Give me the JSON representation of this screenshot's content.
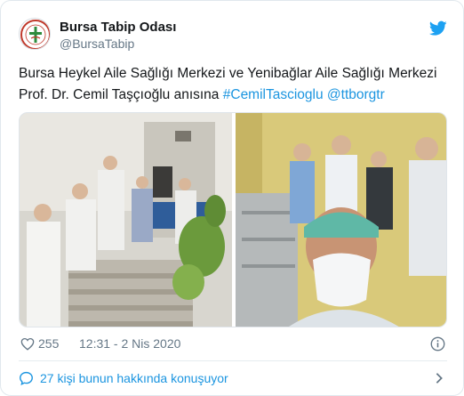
{
  "account": {
    "display_name": "Bursa Tabip Odası",
    "handle": "@BursaTabip",
    "avatar_icon": "bursa-tabip-odasi-logo",
    "platform_icon": "twitter-bird-icon"
  },
  "tweet": {
    "text_plain": "Bursa Heykel Aile Sağlığı Merkezi ve Yenibağlar Aile Sağlığı Merkezi Prof. Dr. Cemil Taşçıoğlu anısına",
    "hashtag": "#CemilTascioglu",
    "mention": "@ttborgtr"
  },
  "media": {
    "photos": [
      "left-photo",
      "right-photo"
    ]
  },
  "meta": {
    "like_count": "255",
    "timestamp": "12:31 - 2 Nis 2020",
    "info_icon": "info-icon"
  },
  "conversation": {
    "label": "27 kişi bunun hakkında konuşuyor"
  },
  "colors": {
    "link": "#1b95e0",
    "text": "#14171a",
    "muted": "#657786",
    "border": "#e1e8ed"
  }
}
